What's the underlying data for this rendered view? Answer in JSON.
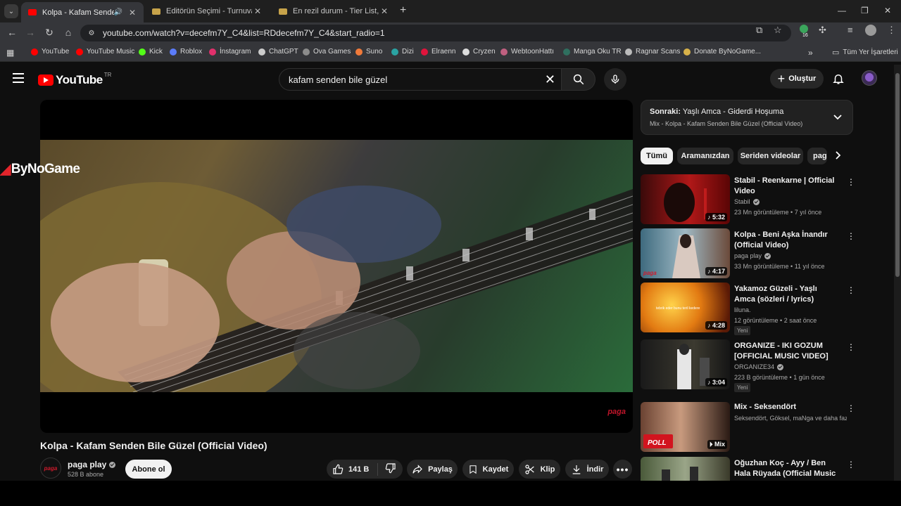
{
  "browser": {
    "tabs": [
      {
        "title": "Kolpa - Kafam Senden Bile Güzel",
        "active": true,
        "favicon_color": "#ff0000"
      },
      {
        "title": "Editörün Seçimi - Turnuva - Qu",
        "active": false,
        "favicon_color": "#c7a34a"
      },
      {
        "title": "En rezil durum - Tier List, Kör Su",
        "active": false,
        "favicon_color": "#c7a34a"
      }
    ],
    "url": "youtube.com/watch?v=decefm7Y_C4&list=RDdecefm7Y_C4&start_radio=1",
    "extension_badge": "16",
    "bookmarks": [
      {
        "label": "YouTube",
        "color": "#ff0000"
      },
      {
        "label": "YouTube Music",
        "color": "#ff0000"
      },
      {
        "label": "Kick",
        "color": "#53fc18"
      },
      {
        "label": "Roblox",
        "color": "#5b7cfa"
      },
      {
        "label": "İnstagram",
        "color": "#e1306c"
      },
      {
        "label": "ChatGPT",
        "color": "#cccccc"
      },
      {
        "label": "Ova Games",
        "color": "#8c8c8c"
      },
      {
        "label": "Suno",
        "color": "#f07a3a"
      },
      {
        "label": "Dizi",
        "color": "#2aa3a3"
      },
      {
        "label": "Elraenn",
        "color": "#e0143c"
      },
      {
        "label": "Cryzen",
        "color": "#dddddd"
      },
      {
        "label": "WebtoonHattı",
        "color": "#c06080"
      },
      {
        "label": "Manga Oku TR",
        "color": "#2f6f5f"
      },
      {
        "label": "Ragnar Scans",
        "color": "#bbbbbb"
      },
      {
        "label": "Donate ByNoGame...",
        "color": "#d8b24a"
      }
    ],
    "all_bookmarks": "Tüm Yer İşaretleri"
  },
  "header": {
    "logo_word": "YouTube",
    "country": "TR",
    "search_query": "kafam senden bile güzel",
    "create_label": "Oluştur"
  },
  "player": {
    "overlay_brand": "ByNoGame",
    "watermark": "paga"
  },
  "video": {
    "title": "Kolpa - Kafam Senden Bile Güzel (Official Video)",
    "channel": "paga play",
    "channel_avatar_text": "paga",
    "subscribers": "528 B abone",
    "subscribe_label": "Abone ol",
    "likes": "141 B",
    "share_label": "Paylaş",
    "save_label": "Kaydet",
    "clip_label": "Klip",
    "download_label": "İndir"
  },
  "mix": {
    "next_prefix": "Sonraki:",
    "next_title": "Yaşlı Amca - Giderdi Hoşuma",
    "subtitle": "Mix - Kolpa - Kafam Senden Bile Güzel (Official Video)"
  },
  "chips": [
    "Tümü",
    "Aramanızdan",
    "Seriden videolar",
    "paga"
  ],
  "recommendations": [
    {
      "title": "Stabil - Reenkarne | Official Video",
      "channel": "Stabil",
      "meta": "23 Mn görüntüleme • 7 yıl önce",
      "duration": "5:32",
      "new": ""
    },
    {
      "title": "Kolpa - Beni Aşka İnandır (Official Video)",
      "channel": "paga play",
      "meta": "33 Mn görüntüleme • 11 yıl önce",
      "duration": "4:17",
      "new": ""
    },
    {
      "title": "Yakamoz Güzeli - Yaşlı Amca (sözleri / lyrics)",
      "channel": "liluna.",
      "meta": "12 görüntüleme • 2 saat önce",
      "duration": "4:28",
      "new": "Yeni"
    },
    {
      "title": "ORGANIZE - IKI GOZUM [OFFICIAL MUSIC VIDEO]",
      "channel": "ORGANIZE34",
      "meta": "223 B görüntüleme • 1 gün önce",
      "duration": "3:04",
      "new": "Yeni"
    },
    {
      "title": "Mix - Seksendört",
      "channel": "",
      "meta": "Seksendört, Göksel, maNga ve daha fazl...",
      "duration": "Mix",
      "new": ""
    },
    {
      "title": "Oğuzhan Koç - Ayy / Ben Hala Rüyada  (Official Music Video)",
      "channel": "",
      "meta": "",
      "duration": "",
      "new": ""
    }
  ],
  "thumb_labels": {
    "yakamoz": "tebrik eder bunu teril kedere",
    "poll": "POLL"
  }
}
